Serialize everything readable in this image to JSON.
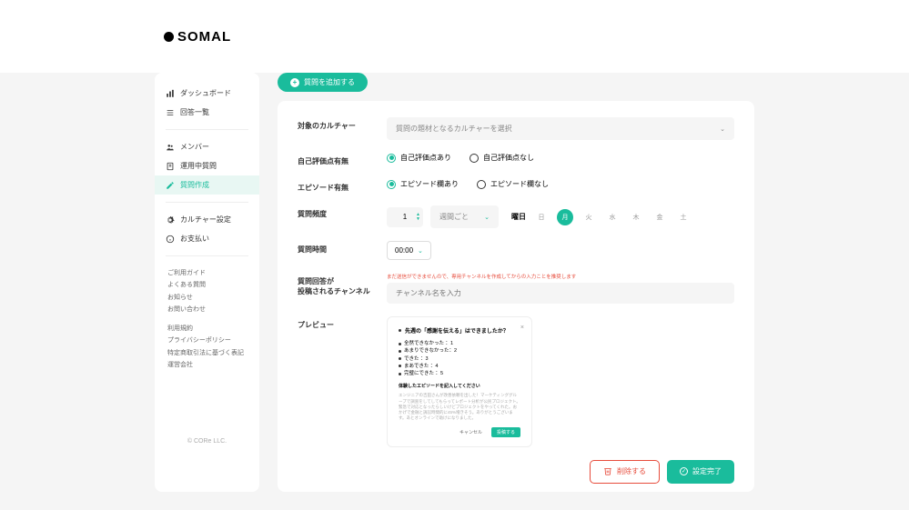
{
  "brand": "SOMAL",
  "sidebar": {
    "items": [
      {
        "label": "ダッシュボード",
        "icon": "chart-icon"
      },
      {
        "label": "回答一覧",
        "icon": "list-icon"
      },
      {
        "label": "メンバー",
        "icon": "members-icon"
      },
      {
        "label": "運用中質問",
        "icon": "doc-icon"
      },
      {
        "label": "質問作成",
        "icon": "pencil-icon"
      },
      {
        "label": "カルチャー設定",
        "icon": "gear-icon"
      },
      {
        "label": "お支払い",
        "icon": "info-icon"
      }
    ],
    "links1": [
      "ご利用ガイド",
      "よくある質問",
      "お知らせ",
      "お問い合わせ"
    ],
    "links2": [
      "利用規約",
      "プライバシーポリシー",
      "特定商取引法に基づく表記",
      "運営会社"
    ],
    "copyright": "© CORe LLC."
  },
  "add_button": "質問を追加する",
  "form": {
    "culture": {
      "label": "対象のカルチャー",
      "placeholder": "質問の題材となるカルチャーを選択"
    },
    "self_eval": {
      "label": "自己評価点有無",
      "yes": "自己評価点あり",
      "no": "自己評価点なし"
    },
    "episode": {
      "label": "エピソード有無",
      "yes": "エピソード欄あり",
      "no": "エピソード欄なし"
    },
    "frequency": {
      "label": "質問頻度",
      "count": "1",
      "unit": "週間ごと",
      "weekday_label": "曜日",
      "days": [
        "日",
        "月",
        "火",
        "水",
        "木",
        "金",
        "土"
      ],
      "active_day": 1
    },
    "time": {
      "label": "質問時間",
      "value": "00:00"
    },
    "channel": {
      "label": "質問回答が\n投稿されるチャンネル",
      "warning": "まだ送信ができませんので、専用チャンネルを作成してからの入力ことを推奨します",
      "placeholder": "チャンネル名を入力"
    },
    "preview": {
      "label": "プレビュー",
      "title": "先週の「感謝を伝える」はできましたか？",
      "options": [
        "全然できなかった ：1",
        "あまりできなかった：2",
        "できた ：3",
        "まあできた ：4",
        "完璧にできた ：5"
      ],
      "episode_prompt": "体験したエピソードを記入してください",
      "body": "エンジニアの吉田さんが改善依頼を出した！マーケティンググループで調査をしてしてもらってレポート分析が公民プロジェクト。緊急で対応となったらしいけどプロジェクトをやってくれた。おかげで金融と訴訟時間的に45%増きそう。ありがとうございます。あとオンラインで助けになりました。",
      "cancel": "キャンセル",
      "submit": "投稿する"
    }
  },
  "actions": {
    "delete": "削除する",
    "confirm": "設定完了"
  }
}
